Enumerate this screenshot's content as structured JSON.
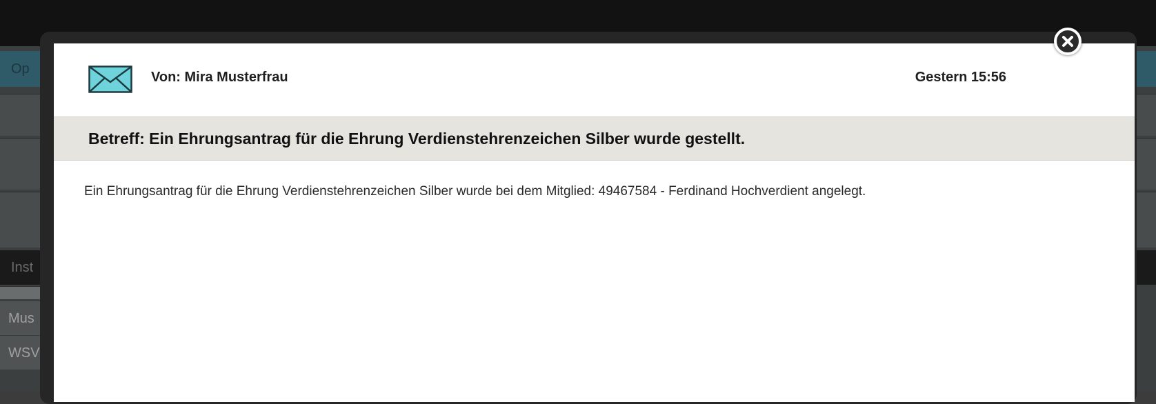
{
  "background": {
    "tab_label": "Op",
    "header_label": "Inst",
    "rows": [
      "Mus",
      "WSV"
    ]
  },
  "message": {
    "from": "Von: Mira Musterfrau",
    "timestamp": "Gestern 15:56",
    "subject": "Betreff: Ein Ehrungsantrag für die Ehrung Verdienstehrenzeichen Silber wurde gestellt.",
    "body": "Ein Ehrungsantrag für die Ehrung Verdienstehrenzeichen Silber wurde bei dem Mitglied: 49467584 - Ferdinand Hochverdient angelegt."
  },
  "icons": {
    "envelope": "envelope-icon",
    "close": "close-icon"
  },
  "colors": {
    "envelope_fill": "#6fd3db",
    "subject_bar": "#e6e4df",
    "overlay_dark": "#262626"
  }
}
